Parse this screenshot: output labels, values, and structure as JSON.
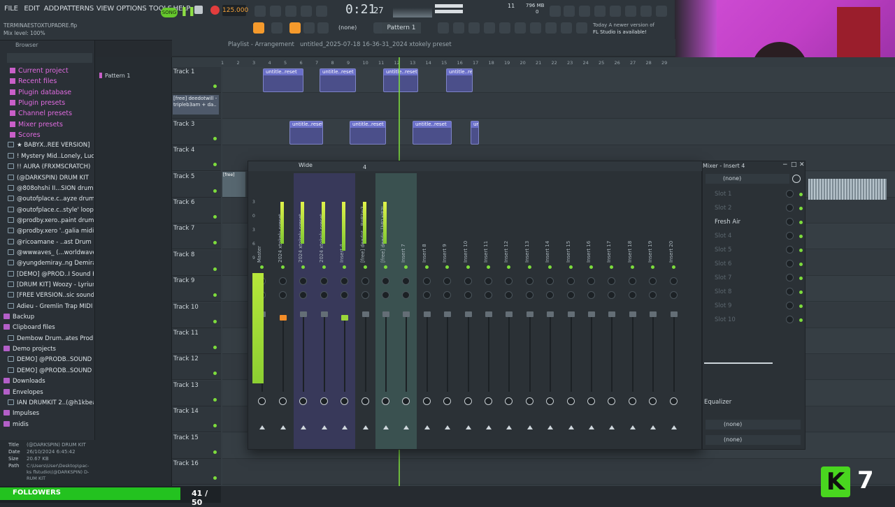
{
  "menu": [
    "FILE",
    "EDIT",
    "ADD",
    "PATTERNS",
    "VIEW",
    "OPTIONS",
    "TOOLS",
    "HELP"
  ],
  "top": {
    "tempo": "125.000",
    "time": "0:21",
    "time_sub": "27",
    "cpu": "11",
    "ram": "796 MB",
    "ram2": "0",
    "song_label": "SONG",
    "pattern_label": "Pattern 1",
    "none_label": "(none)",
    "news_line1": "Today  A newer version of",
    "news_line2": "FL Studio is available!",
    "hint_title": "TERMINAESTOXTUPADRE.flp",
    "hint_sub": "Mix level: 100%"
  },
  "browser": {
    "title": "Browser",
    "items": [
      {
        "label": "Current project",
        "type": "cat"
      },
      {
        "label": "Recent files",
        "type": "cat"
      },
      {
        "label": "Plugin database",
        "type": "cat"
      },
      {
        "label": "Plugin presets",
        "type": "cat"
      },
      {
        "label": "Channel presets",
        "type": "cat"
      },
      {
        "label": "Mixer presets",
        "type": "cat"
      },
      {
        "label": "Scores",
        "type": "cat"
      },
      {
        "label": "★ BABYX..REE VERSION]",
        "type": "file"
      },
      {
        "label": "! Mystery Mid..Lonely, Lucki)",
        "type": "file"
      },
      {
        "label": "!! AURA (FRXMSCRATCH)",
        "type": "file"
      },
      {
        "label": "(@DARKSPIN) DRUM KIT",
        "type": "file"
      },
      {
        "label": "@808ohshi II...SION drum kit",
        "type": "file"
      },
      {
        "label": "@outofplace.c..ayze drum kit",
        "type": "file"
      },
      {
        "label": "@outofplace.c..style' loop kit",
        "type": "file"
      },
      {
        "label": "@prodby.xero..paint drum kit",
        "type": "file"
      },
      {
        "label": "@prodby.xero '..galia midi kit",
        "type": "file"
      },
      {
        "label": "@ricoamane - ..ast Drum Kit",
        "type": "file"
      },
      {
        "label": "@wwwaves_ (...worldwaves)",
        "type": "file"
      },
      {
        "label": "@yungdemiray..ng Demiray}",
        "type": "file"
      },
      {
        "label": "[DEMO] @PROD..I Sound Kit",
        "type": "file"
      },
      {
        "label": "[DRUM KIT] Woozy - Lyrium",
        "type": "file"
      },
      {
        "label": "[FREE VERSION..sic sound kit",
        "type": "file"
      },
      {
        "label": "Adieu - Gremlin Trap MIDI",
        "type": "file"
      },
      {
        "label": "Backup",
        "type": "dir"
      },
      {
        "label": "Clipboard files",
        "type": "dir"
      },
      {
        "label": "Dembow Drum..ates Produce",
        "type": "file"
      },
      {
        "label": "Demo projects",
        "type": "dir"
      },
      {
        "label": "DEMO] @PRODB..SOUND KIT",
        "type": "file"
      },
      {
        "label": "DEMO] @PRODB..SOUND KIT",
        "type": "file"
      },
      {
        "label": "Downloads",
        "type": "dir"
      },
      {
        "label": "Envelopes",
        "type": "dir"
      },
      {
        "label": "IAN DRUMKIT 2..(@h1kbeats)",
        "type": "file"
      },
      {
        "label": "Impulses",
        "type": "dir"
      },
      {
        "label": "midis",
        "type": "dir"
      }
    ],
    "info": {
      "title_k": "Title",
      "title_v": "(@DARKSPIN) DRUM KIT",
      "date_k": "Date",
      "date_v": "26/10/2024 6:45:42",
      "size_k": "Size",
      "size_v": "20.67 KB",
      "path_k": "Path",
      "path_v": "C:\\Users\\User\\Desktop\\pac-ks flstudio\\(@DARKSPIN) D-RUM KIT"
    }
  },
  "patterns": {
    "item": "Pattern 1"
  },
  "playlist": {
    "title": "Playlist - Arrangement",
    "path": "untitled_2025-07-18 16-36-31_2024 xtokely preset",
    "ruler": [
      "1",
      "2",
      "3",
      "4",
      "5",
      "6",
      "7",
      "8",
      "9",
      "10",
      "11",
      "12",
      "13",
      "14",
      "15",
      "16",
      "17",
      "18",
      "19",
      "20",
      "21",
      "22",
      "23",
      "24",
      "25",
      "26",
      "27",
      "28",
      "29"
    ],
    "tracks": [
      "Track 1",
      "",
      "Track 3",
      "Track 4",
      "Track 5",
      "Track 6",
      "Track 7",
      "Track 8",
      "Track 9",
      "Track 10",
      "Track 11",
      "Track 12",
      "Track 13",
      "Track 14",
      "Track 15",
      "Track 16"
    ],
    "track2": "[free] deedotwill - tripleb3am + da..",
    "clip_label": "untitle..reset",
    "track5_clip": "[free]"
  },
  "mixer": {
    "title": "Wide",
    "strip_labels": [
      "Master",
      "2024 xtokely preset",
      "2024 xtokely preset",
      "2024 xtokely preset",
      "Insert 4",
      "[free] deedot...BgP3w3k5p0",
      "[free] deedo..[bP1aj83t8c0]",
      "Insert 7",
      "Insert 8",
      "Insert 9",
      "Insert 10",
      "Insert 11",
      "Insert 12",
      "Insert 13",
      "Insert 14",
      "Insert 15",
      "Insert 16",
      "Insert 17",
      "Insert 18",
      "Insert 19",
      "Insert 20"
    ],
    "strip_num": "4",
    "db_scale": [
      "3",
      "0",
      "3",
      "6",
      "9"
    ]
  },
  "insert": {
    "title": "Mixer - Insert 4",
    "preset": "(none)",
    "slots": [
      "Slot 1",
      "Slot 2",
      "Fresh Air",
      "Slot 4",
      "Slot 5",
      "Slot 6",
      "Slot 7",
      "Slot 8",
      "Slot 9",
      "Slot 10"
    ],
    "eq": "Equalizer",
    "in": "(none)",
    "out": "(none)"
  },
  "followers": {
    "label": "FOLLOWERS",
    "count": "41 / 50"
  },
  "overlay_num": "7"
}
